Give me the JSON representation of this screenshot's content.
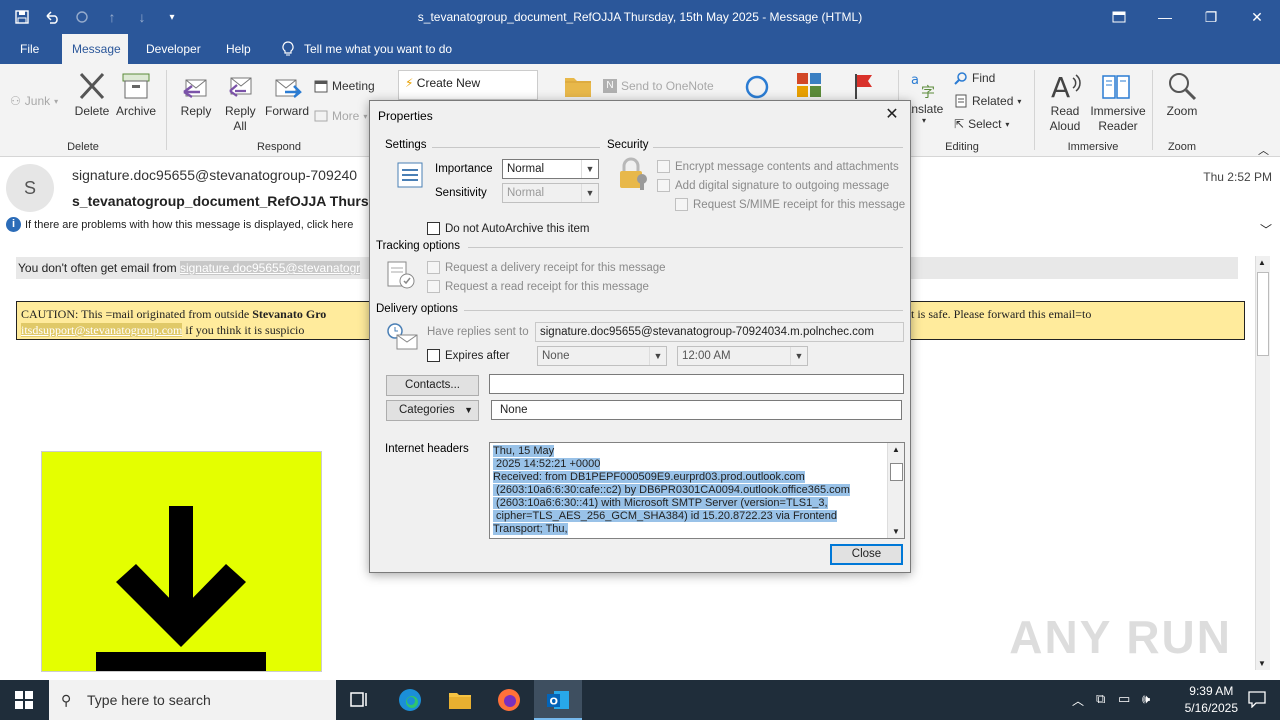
{
  "window": {
    "title": "s_tevanatogroup_document_RefOJJA Thursday, 15th May 2025  -  Message (HTML)"
  },
  "tabs": [
    "File",
    "Message",
    "Developer",
    "Help"
  ],
  "tell_me": "Tell me what you want to do",
  "ribbon": {
    "junk": "Junk",
    "delete": "Delete",
    "archive": "Archive",
    "delete_group": "Delete",
    "reply": "Reply",
    "reply_all": "Reply All",
    "forward": "Forward",
    "meeting": "Meeting",
    "more": "More",
    "respond_group": "Respond",
    "create_new": "Create New",
    "send_onenote": "Send to OneNote",
    "translate": "anslate",
    "find": "Find",
    "related": "Related",
    "select": "Select",
    "editing_group": "Editing",
    "read_aloud": "Read Aloud",
    "immersive_reader": "Immersive Reader",
    "immersive_group": "Immersive",
    "zoom": "Zoom",
    "zoom_group": "Zoom"
  },
  "message": {
    "avatar_letter": "S",
    "from": "signature.doc95655@stevanatogroup-709240",
    "subject": "s_tevanatogroup_document_RefOJJA Thursd",
    "time": "Thu 2:52 PM",
    "info": "If there are problems with how this message is displayed, click here",
    "dont_often": "You don't often get email from ",
    "dont_often_addr": "signature.doc95655@stevanatogr",
    "caution_prefix": "CAUTION: This =mail originated from outside ",
    "caution_bold": "Stevanato Gro",
    "caution_suffix": "nt is safe. Please forward this email=to",
    "caution_link": "itsdsupport@stevanatogroup.com",
    "caution_line2": " if you think it is suspicio"
  },
  "dialog": {
    "title": "Properties",
    "settings": "Settings",
    "importance_label": "Importance",
    "importance_value": "Normal",
    "sensitivity_label": "Sensitivity",
    "sensitivity_value": "Normal",
    "autoarchive": "Do not AutoArchive this item",
    "security": "Security",
    "encrypt": "Encrypt message contents and attachments",
    "digital_sig": "Add digital signature to outgoing message",
    "smime": "Request S/MIME receipt for this message",
    "tracking": "Tracking options",
    "delivery_receipt": "Request a delivery receipt for this message",
    "read_receipt": "Request a read receipt for this message",
    "delivery": "Delivery options",
    "replies_label": "Have replies sent to",
    "replies_value": "signature.doc95655@stevanatogroup-70924034.m.polnchec.com",
    "expires_label": "Expires after",
    "expires_date": "None",
    "expires_time": "12:00 AM",
    "contacts_btn": "Contacts...",
    "categories_btn": "Categories",
    "categories_value": "None",
    "headers_label": "Internet headers",
    "headers_lines": [
      "Thu, 15 May",
      " 2025 14:52:21 +0000",
      "Received: from DB1PEPF000509E9.eurprd03.prod.outlook.com",
      " (2603:10a6:6:30:cafe::c2) by DB6PR0301CA0094.outlook.office365.com",
      " (2603:10a6:6:30::41) with Microsoft SMTP Server (version=TLS1_3,",
      " cipher=TLS_AES_256_GCM_SHA384) id 15.20.8722.23 via Frontend",
      "Transport; Thu,"
    ],
    "close_btn": "Close"
  },
  "taskbar": {
    "search_placeholder": "Type here to search",
    "time": "9:39 AM",
    "date": "5/16/2025"
  },
  "watermark": "ANY RUN"
}
